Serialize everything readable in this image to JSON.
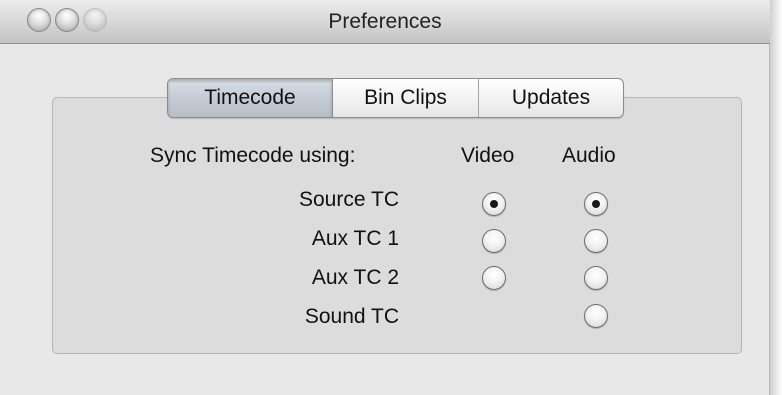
{
  "window": {
    "title": "Preferences"
  },
  "tabs": [
    {
      "label": "Timecode",
      "selected": true
    },
    {
      "label": "Bin Clips",
      "selected": false
    },
    {
      "label": "Updates",
      "selected": false
    }
  ],
  "timecode": {
    "sync_label": "Sync Timecode using:",
    "columns": {
      "video": "Video",
      "audio": "Audio"
    },
    "rows": [
      {
        "label": "Source TC",
        "video": true,
        "audio": true
      },
      {
        "label": "Aux TC 1",
        "video": false,
        "audio": false
      },
      {
        "label": "Aux TC 2",
        "video": false,
        "audio": false
      },
      {
        "label": "Sound TC",
        "video": null,
        "audio": false
      }
    ]
  }
}
